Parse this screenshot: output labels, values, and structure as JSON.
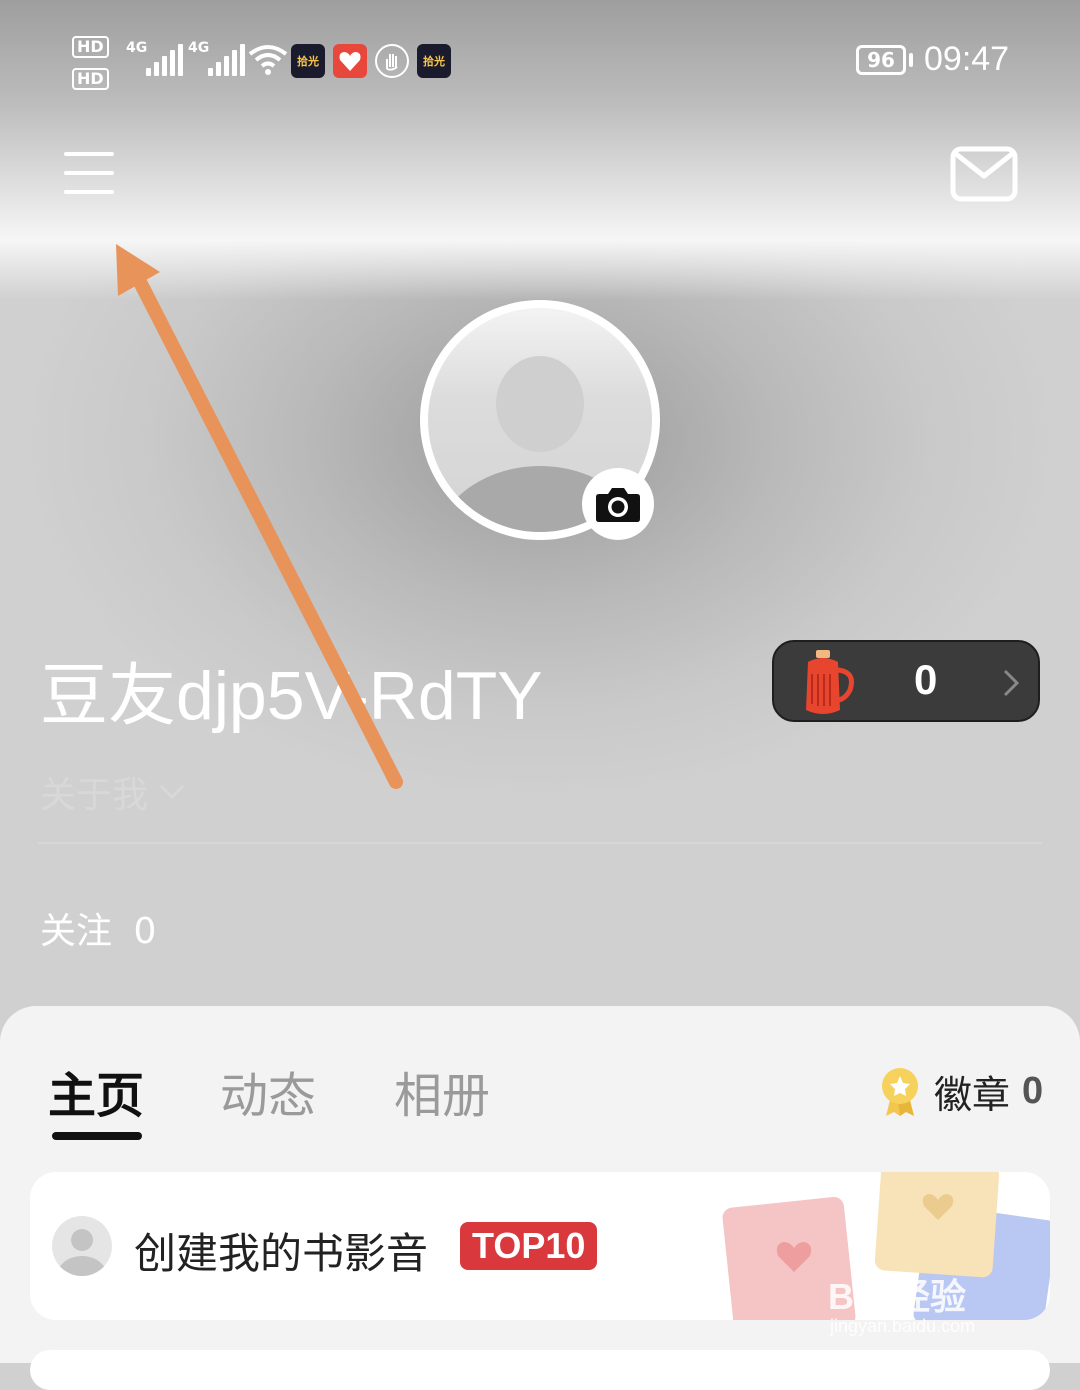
{
  "status_bar": {
    "sim1": "HD",
    "sim2": "HD",
    "net1": "4G",
    "net2": "4G",
    "app_icon_1": "拾光",
    "app_icon_3": "拾光",
    "battery": "96",
    "time": "09:47"
  },
  "profile": {
    "username": "豆友djp5V-RdTY",
    "about_label": "关于我",
    "follow_label": "关注",
    "follow_count": "0",
    "coin_count": "0"
  },
  "tabs": [
    {
      "label": "主页",
      "active": true
    },
    {
      "label": "动态",
      "active": false
    },
    {
      "label": "相册",
      "active": false
    }
  ],
  "badges": {
    "label": "徽章",
    "count": "0"
  },
  "card": {
    "title": "创建我的书影音",
    "tag": "TOP10"
  },
  "watermark": {
    "main": "Bai 经验",
    "sub": "jingyan.baidu.com"
  },
  "colors": {
    "accent_red": "#d9393d",
    "annotation_arrow": "#e8935a"
  }
}
